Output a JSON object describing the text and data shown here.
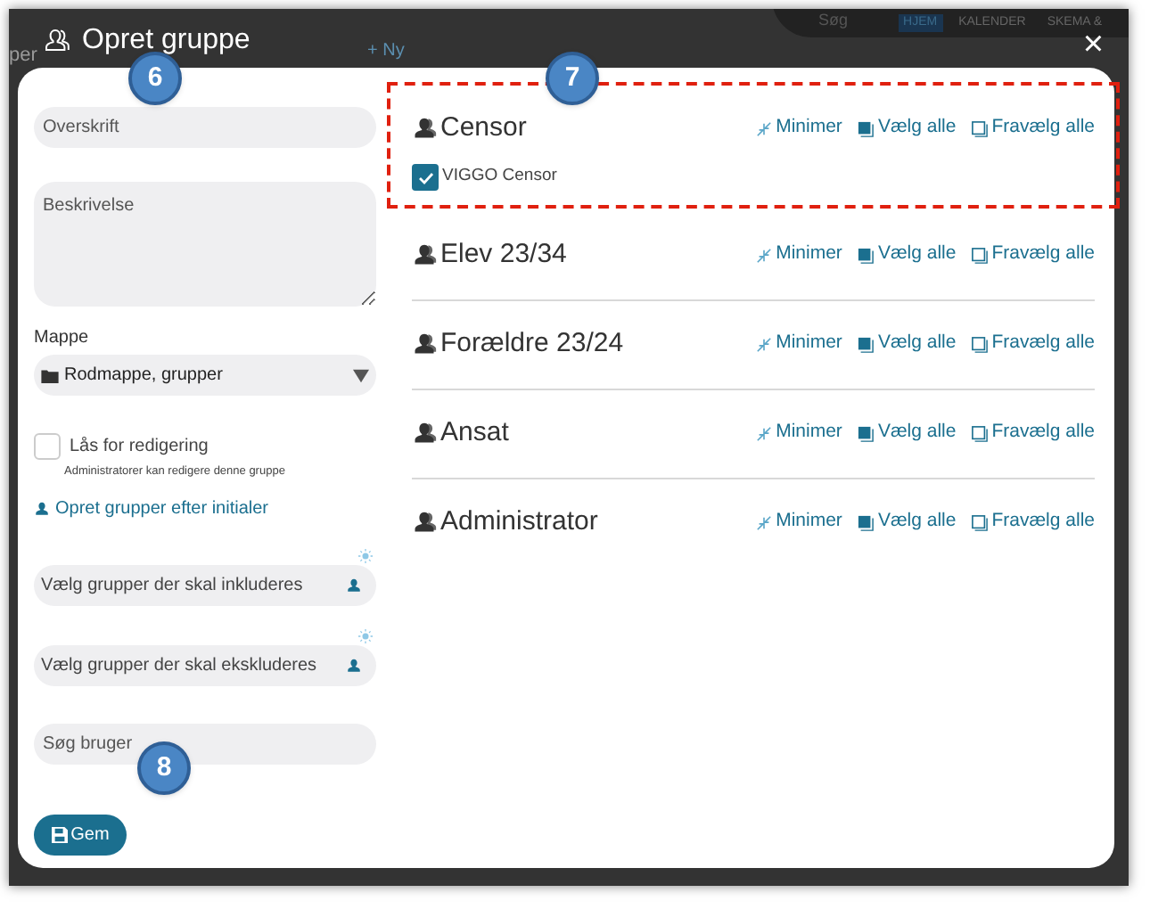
{
  "background": {
    "heading": "per",
    "new_link": "+ Ny",
    "search": "Søg",
    "nav": [
      {
        "label": "HJEM",
        "selected": true
      },
      {
        "label": "KALENDER",
        "selected": false
      },
      {
        "label": "SKEMA &",
        "selected": false
      }
    ]
  },
  "dialog": {
    "title": "Opret gruppe",
    "close": "×"
  },
  "form": {
    "title_field": {
      "placeholder": "Overskrift"
    },
    "description_field": {
      "placeholder": "Beskrivelse"
    },
    "folder": {
      "label": "Mappe",
      "value": "Rodmappe, grupper"
    },
    "lock": {
      "label": "Lås for redigering",
      "hint": "Administratorer kan redigere denne gruppe",
      "checked": false
    },
    "initials_link": "Opret grupper efter initialer",
    "include_field": {
      "placeholder": "Vælg grupper der skal inkluderes"
    },
    "exclude_field": {
      "placeholder": "Vælg grupper der skal ekskluderes"
    },
    "user_search": {
      "placeholder": "Søg bruger"
    },
    "save_button": "Gem"
  },
  "groups": [
    {
      "name": "Censor",
      "highlighted": true,
      "minimize": "Minimer",
      "select_all": "Vælg alle",
      "deselect_all": "Fravælg alle",
      "members": [
        {
          "label": "VIGGO Censor",
          "checked": true
        }
      ]
    },
    {
      "name": "Elev 23/34",
      "highlighted": false,
      "minimize": "Minimer",
      "select_all": "Vælg alle",
      "deselect_all": "Fravælg alle"
    },
    {
      "name": "Forældre 23/24",
      "highlighted": false,
      "minimize": "Minimer",
      "select_all": "Vælg alle",
      "deselect_all": "Fravælg alle"
    },
    {
      "name": "Ansat",
      "highlighted": false,
      "minimize": "Minimer",
      "select_all": "Vælg alle",
      "deselect_all": "Fravælg alle"
    },
    {
      "name": "Administrator",
      "highlighted": false,
      "minimize": "Minimer",
      "select_all": "Vælg alle",
      "deselect_all": "Fravælg alle"
    }
  ],
  "callouts": [
    {
      "number": "6"
    },
    {
      "number": "7"
    },
    {
      "number": "8"
    }
  ]
}
